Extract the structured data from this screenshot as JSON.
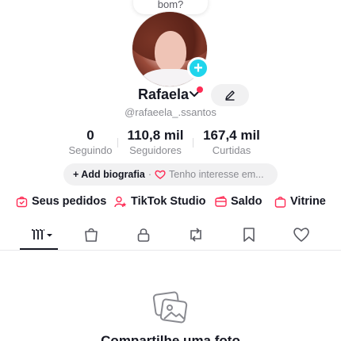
{
  "tooltip": {
    "text": "bom?"
  },
  "profile": {
    "name": "Rafaela",
    "handle": "@rafaeela_.ssantos"
  },
  "stats": [
    {
      "value": "0",
      "label": "Seguindo"
    },
    {
      "value": "110,8 mil",
      "label": "Seguidores"
    },
    {
      "value": "167,4 mil",
      "label": "Curtidas"
    }
  ],
  "bio": {
    "add_label": "+ Add biografia",
    "separator": "·",
    "interest": "Tenho interesse em..."
  },
  "shortcuts": [
    {
      "label": "Seus pedidos",
      "icon": "orders-icon"
    },
    {
      "label": "TikTok Studio",
      "icon": "studio-icon"
    },
    {
      "label": "Saldo",
      "icon": "wallet-icon"
    },
    {
      "label": "Vitrine",
      "icon": "showcase-icon"
    }
  ],
  "tabs": [
    {
      "icon": "videos-grid-icon",
      "active": true
    },
    {
      "icon": "shop-bag-icon"
    },
    {
      "icon": "lock-icon"
    },
    {
      "icon": "repost-icon"
    },
    {
      "icon": "bookmark-icon"
    },
    {
      "icon": "heart-icon"
    }
  ],
  "empty_state": {
    "title": "Compartilhe uma foto"
  },
  "colors": {
    "accent": "#fe2c55",
    "badge": "#20d5ec",
    "text": "#161823",
    "muted": "#8a8b91"
  }
}
